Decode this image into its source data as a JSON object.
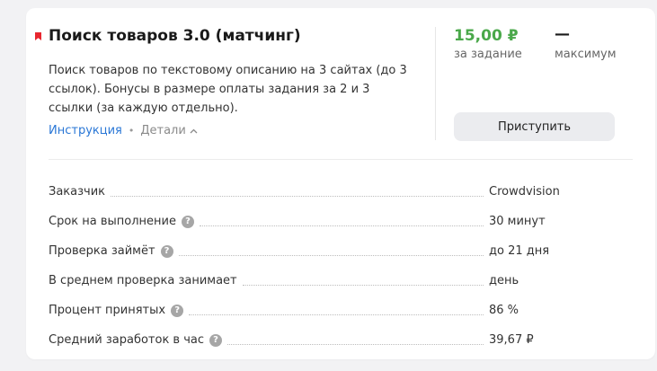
{
  "task": {
    "title": "Поиск товаров 3.0 (матчинг)",
    "description": "Поиск товаров по текстовому описанию на 3 сайтах (до 3 ссылок). Бонусы в размере оплаты задания за 2 и 3 ссылки (за каждую отдельно).",
    "instruction_link": "Инструкция",
    "separator": "•",
    "details_link": "Детали"
  },
  "reward": {
    "price": "15,00 ₽",
    "price_label": "за задание",
    "max_value": "—",
    "max_label": "максимум",
    "start_button": "Приступить"
  },
  "info": {
    "rows": [
      {
        "label": "Заказчик",
        "value": "Crowdvision",
        "help": false
      },
      {
        "label": "Срок на выполнение",
        "value": "30 минут",
        "help": true
      },
      {
        "label": "Проверка займёт",
        "value": "до 21 дня",
        "help": true
      },
      {
        "label": "В среднем проверка занимает",
        "value": "день",
        "help": false
      },
      {
        "label": "Процент принятых",
        "value": "86 %",
        "help": true
      },
      {
        "label": "Средний заработок в час",
        "value": "39,67 ₽",
        "help": true
      }
    ],
    "help_glyph": "?"
  },
  "colors": {
    "price_green": "#4aa84a",
    "bookmark_red": "#e8262f",
    "link_blue": "#2a77d6",
    "button_bg": "#ebecef"
  }
}
